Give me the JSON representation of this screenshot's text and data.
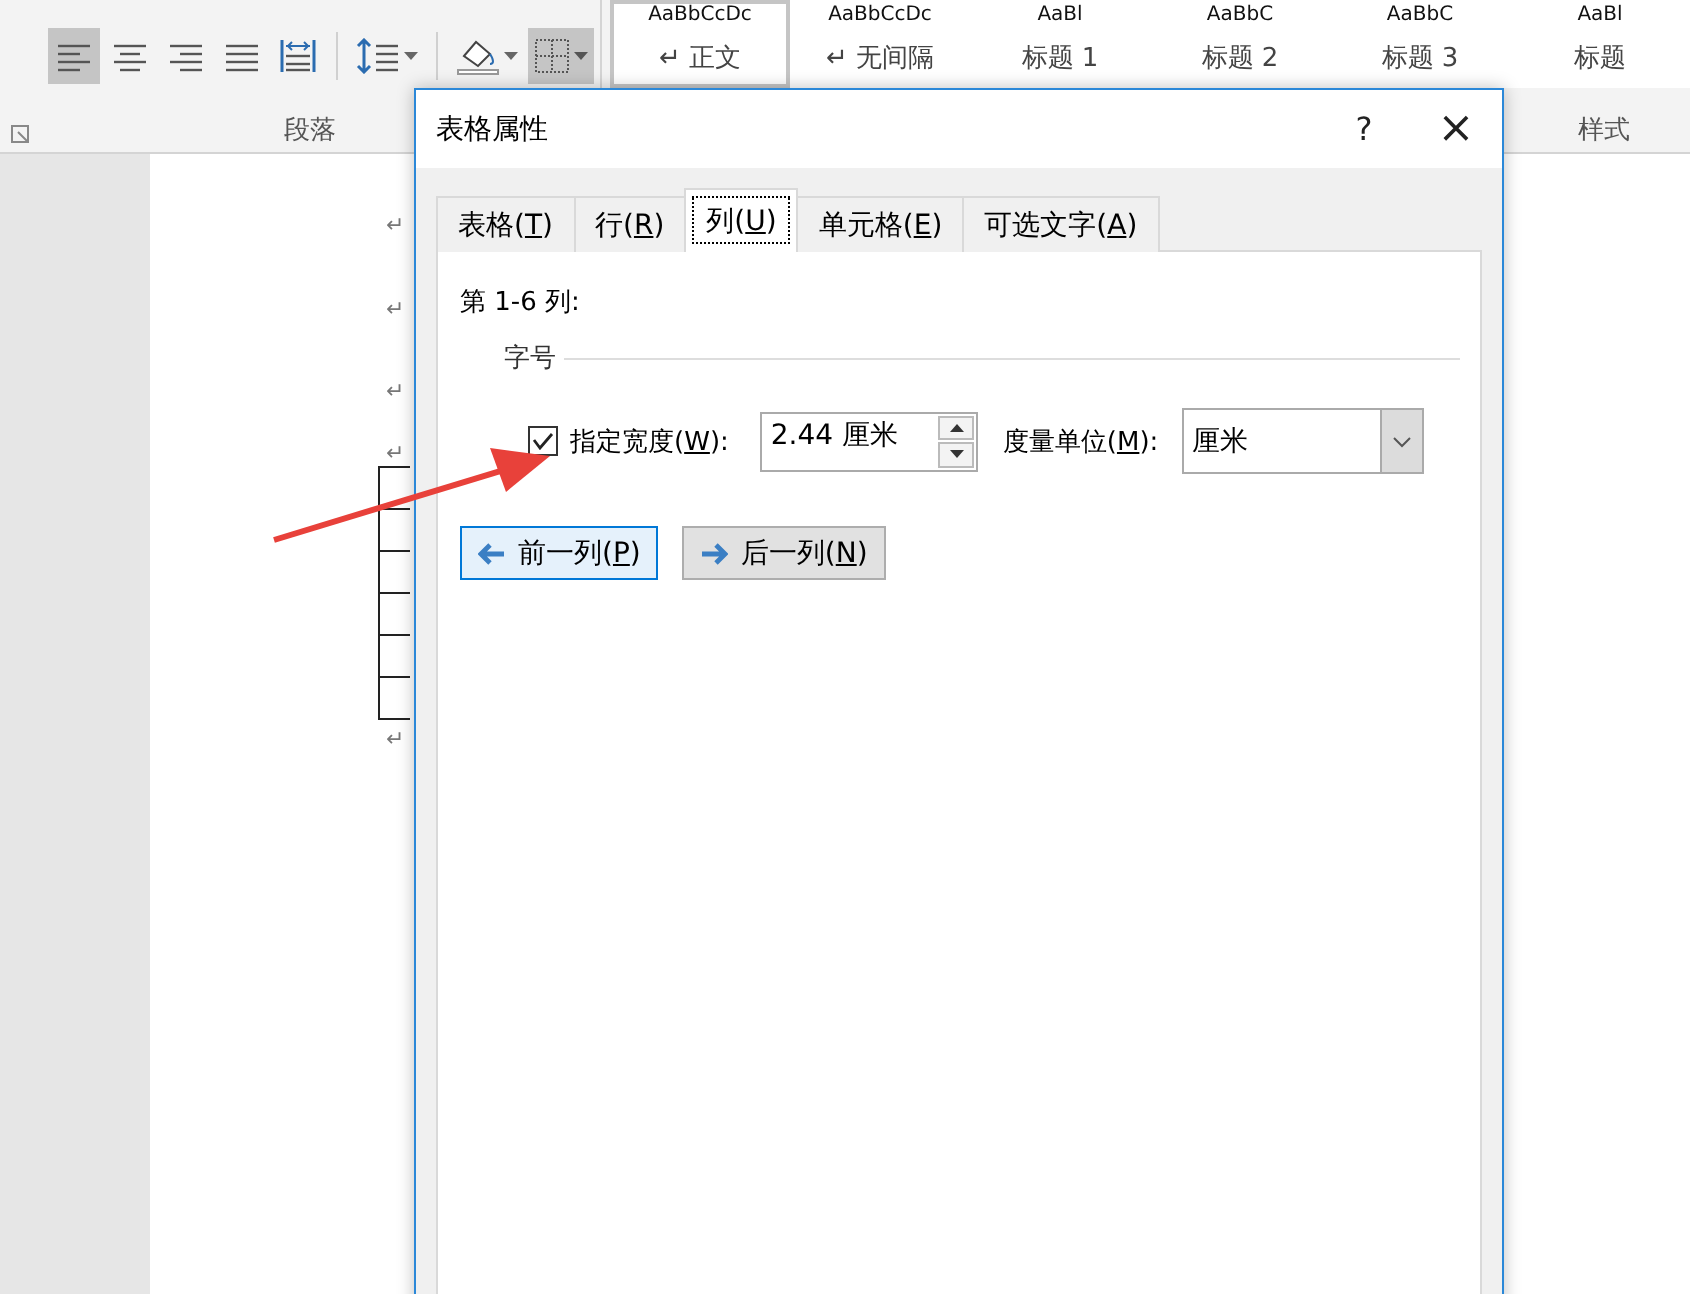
{
  "ribbon": {
    "paragraph": {
      "label": "段落",
      "tools": [
        {
          "kind": "align-left",
          "selected": true
        },
        {
          "kind": "align-center",
          "selected": false
        },
        {
          "kind": "align-right",
          "selected": false
        },
        {
          "kind": "justify",
          "selected": false
        },
        {
          "kind": "distribute",
          "selected": false
        },
        {
          "kind": "line-spacing",
          "selected": false
        },
        {
          "kind": "shading",
          "selected": false
        },
        {
          "kind": "borders",
          "selected": true
        }
      ]
    },
    "styles": {
      "label": "样式",
      "items": [
        {
          "preview": "AaBbCcDc",
          "name": "↵ 正文",
          "selected": true
        },
        {
          "preview": "AaBbCcDc",
          "name": "↵ 无间隔",
          "selected": false
        },
        {
          "preview": "AaBl",
          "name": "标题 1",
          "selected": false
        },
        {
          "preview": "AaBbC",
          "name": "标题 2",
          "selected": false
        },
        {
          "preview": "AaBbC",
          "name": "标题 3",
          "selected": false
        },
        {
          "preview": "AaBl",
          "name": "标题",
          "selected": false
        }
      ]
    }
  },
  "document": {
    "marks_before": [
      "↵",
      "↵",
      "↵",
      "↵"
    ],
    "marks_after": [
      "↵"
    ]
  },
  "dialog": {
    "title": "表格属性",
    "help": "?",
    "close": "×",
    "tabs": [
      {
        "label": "表格(T)",
        "selected": false
      },
      {
        "label": "行(R)",
        "selected": false
      },
      {
        "label": "列(U)",
        "selected": true
      },
      {
        "label": "单元格(E)",
        "selected": false
      },
      {
        "label": "可选文字(A)",
        "selected": false
      }
    ],
    "heading": "第 1-6 列:",
    "group": "字号",
    "width": {
      "label": "指定宽度(W):",
      "checked": true,
      "value": "2.44 厘米"
    },
    "unit": {
      "label": "度量单位(M):",
      "value": "厘米"
    },
    "buttons": [
      {
        "label": "前一列(P)",
        "kind": "previous",
        "selected": true
      },
      {
        "label": "后一列(N)",
        "kind": "next",
        "selected": false
      }
    ]
  }
}
